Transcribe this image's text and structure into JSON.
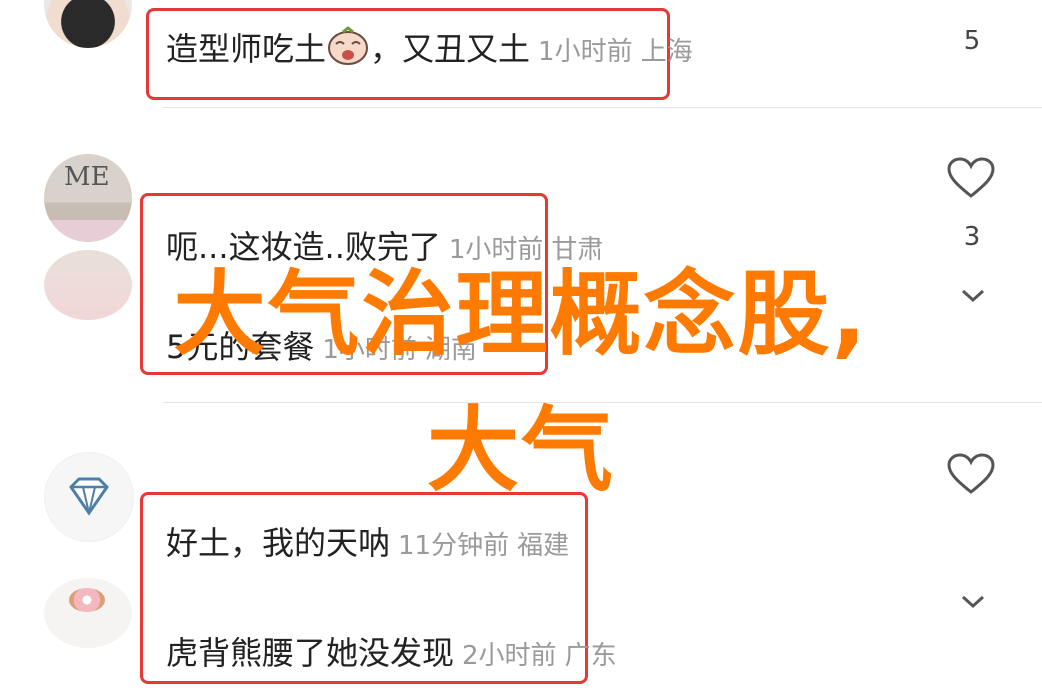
{
  "comments": [
    {
      "text": "造型师吃土",
      "suffix": "，又丑又土",
      "time": "1小时前",
      "location": "上海",
      "likes": "5"
    },
    {
      "text": "呃...这妆造..败完了",
      "time": "1小时前",
      "location": "甘肃",
      "likes": "3"
    },
    {
      "text": "5元的套餐",
      "time": "1小时前",
      "location": "湖南"
    },
    {
      "text": "好土，我的天呐",
      "time": "11分钟前",
      "location": "福建"
    },
    {
      "text": "虎背熊腰了她没发现",
      "time": "2小时前",
      "location": "广东"
    }
  ],
  "avatars": {
    "me_text": "ME"
  },
  "overlay": {
    "line1": "大气治理概念股,",
    "line2": "大气"
  },
  "colors": {
    "accent": "#ff7a00",
    "highlight_box": "#e53935",
    "meta_gray": "#9a9a9a"
  },
  "icons": [
    "heart-outline-icon",
    "chevron-down-icon",
    "diamond-icon",
    "crying-face-emoji"
  ]
}
